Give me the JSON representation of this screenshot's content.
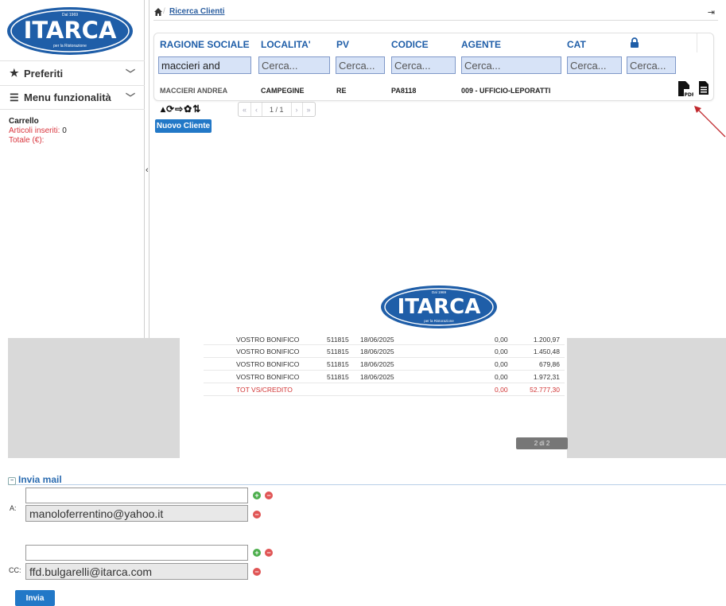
{
  "brand": {
    "name": "ITARCA",
    "since": "Dal 1969",
    "tagline": "per la Ristorazione",
    "color_primary": "#1f5ea8",
    "color_light": "#3c8fd6"
  },
  "sidebar": {
    "items": [
      {
        "label": "Preferiti",
        "icon": "star-icon"
      },
      {
        "label": "Menu funzionalità",
        "icon": "hamburger-icon"
      }
    ],
    "cart": {
      "title": "Carrello",
      "items_label": "Articoli inseriti:",
      "items_value": "0",
      "total_label": "Totale (€):"
    }
  },
  "breadcrumb": {
    "current": "Ricerca Clienti"
  },
  "grid": {
    "columns": [
      "RAGIONE SOCIALE",
      "LOCALITA'",
      "PV",
      "CODICE",
      "AGENTE",
      "CAT"
    ],
    "filters": [
      {
        "value": "maccieri and",
        "placeholder": "Cerca..."
      },
      {
        "value": "",
        "placeholder": "Cerca..."
      },
      {
        "value": "",
        "placeholder": "Cerca..."
      },
      {
        "value": "",
        "placeholder": "Cerca..."
      },
      {
        "value": "",
        "placeholder": "Cerca..."
      },
      {
        "value": "",
        "placeholder": "Cerca..."
      },
      {
        "value": "",
        "placeholder": "Cerca..."
      }
    ],
    "rows": [
      {
        "ragione_sociale": "MACCIERI ANDREA",
        "localita": "CAMPEGINE",
        "pv": "RE",
        "codice": "PA8118",
        "agente": "009 - UFFICIO-LEPORATTI"
      }
    ]
  },
  "pager": {
    "first": "«",
    "prev": "‹",
    "info": "1 / 1",
    "next": "›",
    "last": "»"
  },
  "buttons": {
    "new_client": "Nuovo Cliente",
    "send": "Invia"
  },
  "pdf_preview": {
    "rows": [
      {
        "desc": "VOSTRO BONIFICO",
        "code": "511815",
        "date": "18/06/2025",
        "a": "0,00",
        "b": "1.200,97"
      },
      {
        "desc": "VOSTRO BONIFICO",
        "code": "511815",
        "date": "18/06/2025",
        "a": "0,00",
        "b": "1.450,48"
      },
      {
        "desc": "VOSTRO BONIFICO",
        "code": "511815",
        "date": "18/06/2025",
        "a": "0,00",
        "b": "679,86"
      },
      {
        "desc": "VOSTRO BONIFICO",
        "code": "511815",
        "date": "18/06/2025",
        "a": "0,00",
        "b": "1.972,31"
      }
    ],
    "total": {
      "desc": "TOT VS/CREDITO",
      "a": "0,00",
      "b": "52.777,30"
    },
    "page_indicator": "2 di 2"
  },
  "mail": {
    "title": "Invia mail",
    "to_label": "A:",
    "cc_label": "CC:",
    "to_input": "",
    "to_address": "manoloferrentino@yahoo.it",
    "cc_input": "",
    "cc_address": "ffd.bulgarelli@itarca.com"
  }
}
